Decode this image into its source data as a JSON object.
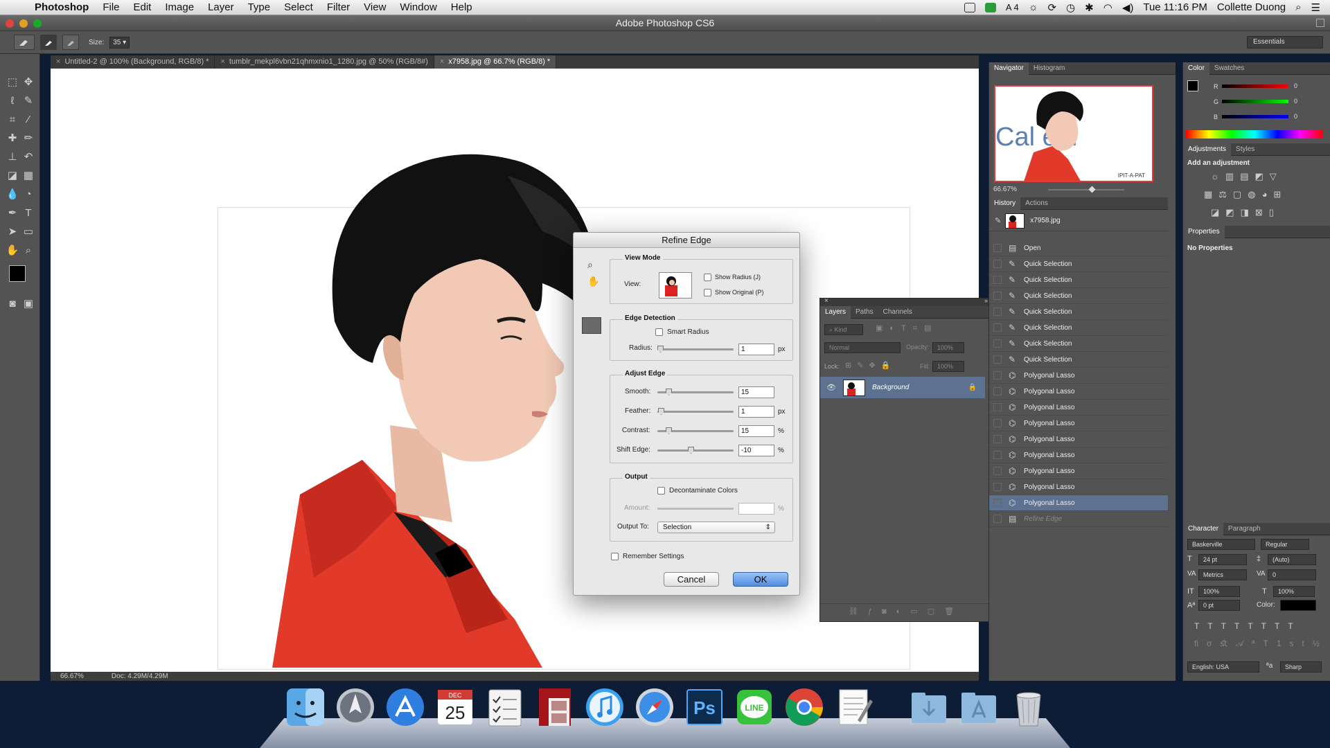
{
  "menubar": {
    "app": "Photoshop",
    "items": [
      "File",
      "Edit",
      "Image",
      "Layer",
      "Type",
      "Select",
      "Filter",
      "View",
      "Window",
      "Help"
    ],
    "tray_count": "4",
    "clock": "Tue 11:16 PM",
    "user": "Collette Duong"
  },
  "window": {
    "title": "Adobe Photoshop CS6"
  },
  "options": {
    "size_label": "Size:",
    "size_value": "35",
    "workspace": "Essentials"
  },
  "doc_tabs": [
    {
      "label": "Untitled-2 @ 100% (Background, RGB/8) *",
      "active": false
    },
    {
      "label": "tumblr_mekpl6vbn21qhmxnio1_1280.jpg @ 50% (RGB/8#)",
      "active": false
    },
    {
      "label": "x7958.jpg @ 66.7% (RGB/8) *",
      "active": true
    }
  ],
  "status": {
    "zoom": "66.67%",
    "doc": "Doc: 4.29M/4.29M"
  },
  "refine_edge": {
    "title": "Refine Edge",
    "view_mode": "View Mode",
    "view_label": "View:",
    "show_radius": "Show Radius (J)",
    "show_original": "Show Original (P)",
    "edge_detection": "Edge Detection",
    "smart_radius": "Smart Radius",
    "radius_label": "Radius:",
    "radius_value": "1",
    "px": "px",
    "adjust_edge": "Adjust Edge",
    "smooth_label": "Smooth:",
    "smooth_value": "15",
    "feather_label": "Feather:",
    "feather_value": "1",
    "contrast_label": "Contrast:",
    "contrast_value": "15",
    "shift_label": "Shift Edge:",
    "shift_value": "-10",
    "percent": "%",
    "output": "Output",
    "decontaminate": "Decontaminate Colors",
    "amount_label": "Amount:",
    "output_to_label": "Output To:",
    "output_to_value": "Selection",
    "remember": "Remember Settings",
    "cancel": "Cancel",
    "ok": "OK"
  },
  "layers_panel": {
    "tabs": [
      "Layers",
      "Paths",
      "Channels"
    ],
    "kind": "Kind",
    "blend": "Normal",
    "opacity_label": "Opacity:",
    "opacity_value": "100%",
    "lock_label": "Lock:",
    "fill_label": "Fill:",
    "fill_value": "100%",
    "layer_name": "Background"
  },
  "navigator": {
    "tabs": [
      "Navigator",
      "Histogram"
    ],
    "zoom": "66.67%",
    "preview_text": "Cal    ein",
    "watermark": "IPIT-A-PAT"
  },
  "history": {
    "tabs": [
      "History",
      "Actions"
    ],
    "snapshot": "x7958.jpg",
    "items": [
      "Open",
      "Quick Selection",
      "Quick Selection",
      "Quick Selection",
      "Quick Selection",
      "Quick Selection",
      "Quick Selection",
      "Quick Selection",
      "Polygonal Lasso",
      "Polygonal Lasso",
      "Polygonal Lasso",
      "Polygonal Lasso",
      "Polygonal Lasso",
      "Polygonal Lasso",
      "Polygonal Lasso",
      "Polygonal Lasso",
      "Polygonal Lasso",
      "Refine Edge"
    ]
  },
  "color_panel": {
    "tabs": [
      "Color",
      "Swatches"
    ],
    "r": "R",
    "g": "G",
    "b": "B",
    "r_value": "0",
    "g_value": "0",
    "b_value": "0"
  },
  "adjustments": {
    "tabs": [
      "Adjustments",
      "Styles"
    ],
    "add": "Add an adjustment"
  },
  "properties": {
    "title": "Properties",
    "empty": "No Properties"
  },
  "character": {
    "tabs": [
      "Character",
      "Paragraph"
    ],
    "font": "Baskerville",
    "style": "Regular",
    "size": "24 pt",
    "leading": "(Auto)",
    "kerning": "Metrics",
    "tracking": "0",
    "vscale": "100%",
    "hscale": "100%",
    "baseline": "0 pt",
    "color_label": "Color:",
    "language": "English: USA",
    "aa": "Sharp"
  },
  "dock": {
    "icons": [
      "finder-icon",
      "launchpad-icon",
      "app-store-icon",
      "calendar-icon",
      "reminders-icon",
      "photo-booth-icon",
      "itunes-icon",
      "safari-icon",
      "photoshop-icon",
      "line-icon",
      "chrome-icon",
      "textedit-icon",
      "downloads-folder-icon",
      "applications-folder-icon",
      "trash-icon"
    ],
    "calendar_month": "DEC",
    "calendar_day": "25",
    "ps_label": "Ps",
    "line_label": "LINE"
  }
}
